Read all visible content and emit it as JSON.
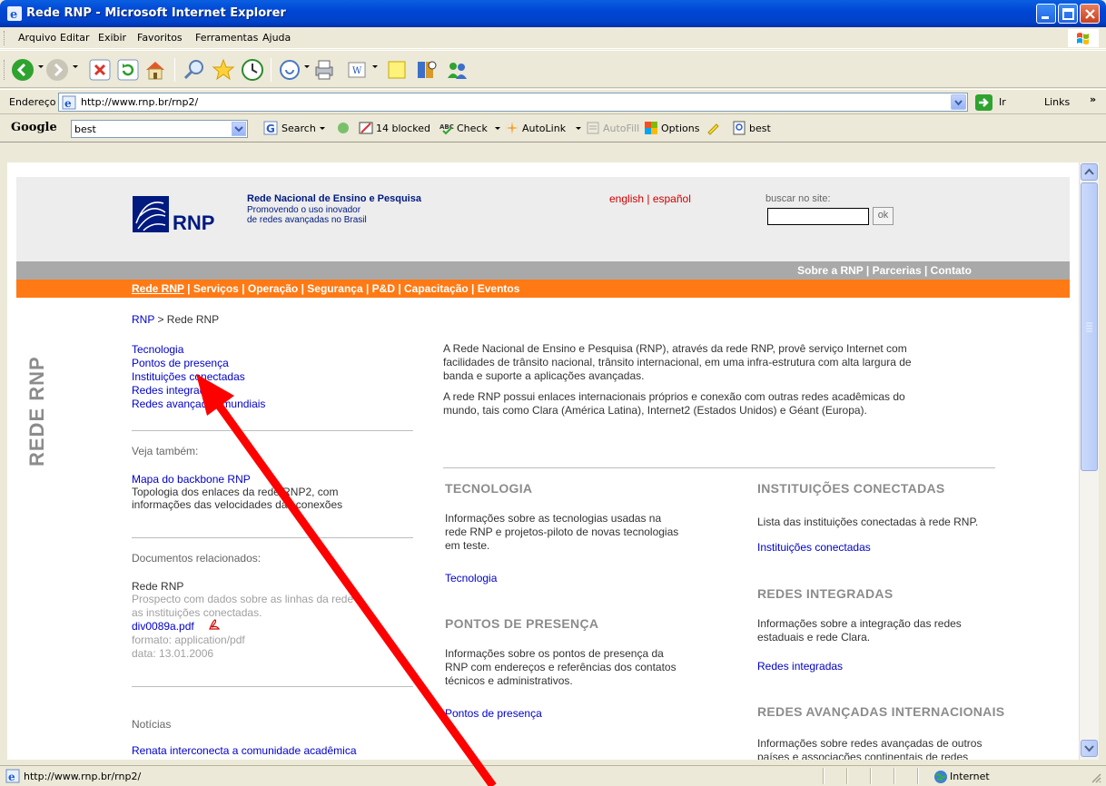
{
  "window": {
    "title": "Rede RNP - Microsoft Internet Explorer"
  },
  "menu": [
    "Arquivo",
    "Editar",
    "Exibir",
    "Favoritos",
    "Ferramentas",
    "Ajuda"
  ],
  "address": {
    "label": "Endereço",
    "url": "http://www.rnp.br/rnp2/",
    "go_label": "Ir",
    "links_label": "Links"
  },
  "google": {
    "logo": "Google",
    "query": "best",
    "search_label": "Search",
    "blocked_label": "14 blocked",
    "check_label": "Check",
    "autolink_label": "AutoLink",
    "autofill_label": "AutoFill",
    "options_label": "Options",
    "highlight_label": "best"
  },
  "site": {
    "org_name": "Rede Nacional de Ensino e Pesquisa",
    "tagline_1": "Promovendo o uso inovador",
    "tagline_2": "de redes avançadas no Brasil",
    "logo_text": "RNP",
    "lang_en": "english",
    "lang_sep": " | ",
    "lang_es": "español",
    "search_label": "buscar no site:",
    "search_button": "ok",
    "top_nav": "Sobre a RNP | Parcerias | Contato",
    "main_nav_first": "Rede RNP",
    "main_nav_rest": " | Serviços | Operação | Segurança | P&D | Capacitação | Eventos",
    "breadcrumb_root": "RNP",
    "breadcrumb_rest": " > Rede RNP",
    "section_vertical": "REDE RNP"
  },
  "left_links": [
    "Tecnologia",
    "Pontos de presença",
    "Instituições conectadas",
    "Redes integradas",
    "Redes avançadas mundiais"
  ],
  "see_also": {
    "heading": "Veja também:",
    "link": "Mapa do backbone RNP",
    "desc_1": "Topologia dos enlaces da rede RNP2, com",
    "desc_2": "informações das velocidades das conexões"
  },
  "docs": {
    "heading": "Documentos relacionados:",
    "title": "Rede RNP",
    "desc_1": "Prospecto com dados sobre as linhas da rede e",
    "desc_2": "as instituições conectadas.",
    "file": "div0089a.pdf",
    "format": "formato: application/pdf",
    "date": "data: 13.01.2006"
  },
  "news": {
    "heading": "Notícias",
    "item": "Renata interconecta a comunidade acadêmica"
  },
  "intro": {
    "p1_l1": "A Rede Nacional de Ensino e Pesquisa (RNP), através da rede RNP, provê serviço Internet com",
    "p1_l2": "facilidades de trânsito nacional, trânsito internacional, em uma infra-estrutura com alta largura de",
    "p1_l3": "banda e suporte a aplicações avançadas.",
    "p2_l1": "A rede RNP possui enlaces internacionais próprios e conexão com outras redes acadêmicas do",
    "p2_l2": "mundo, tais como Clara (América Latina), Internet2 (Estados Unidos) e Géant (Europa)."
  },
  "sections": {
    "tecnologia": {
      "title": "TECNOLOGIA",
      "l1": "Informações sobre as tecnologias usadas na",
      "l2": "rede RNP e projetos-piloto de novas tecnologias",
      "l3": "em teste.",
      "link": "Tecnologia"
    },
    "pontos": {
      "title": "PONTOS DE PRESENÇA",
      "l1": "Informações sobre os pontos de presença da",
      "l2": "RNP com endereços e referências dos contatos",
      "l3": "técnicos e administrativos.",
      "link": "Pontos de presença"
    },
    "instituicoes": {
      "title": "INSTITUIÇÕES CONECTADAS",
      "l1": "Lista das instituições conectadas à rede RNP.",
      "link": "Instituições conectadas"
    },
    "integradas": {
      "title": "REDES INTEGRADAS",
      "l1": "Informações sobre a integração das redes",
      "l2": "estaduais e rede Clara.",
      "link": "Redes integradas"
    },
    "avancadas": {
      "title": "REDES AVANÇADAS INTERNACIONAIS",
      "l1": "Informações sobre redes avançadas de outros",
      "l2": "países e associações continentais de redes"
    }
  },
  "status": {
    "url": "http://www.rnp.br/rnp2/",
    "zone": "Internet"
  },
  "colors": {
    "orange_nav": "#FF7A15",
    "link_blue": "#0000CC",
    "arrow_red": "#FF0000"
  }
}
